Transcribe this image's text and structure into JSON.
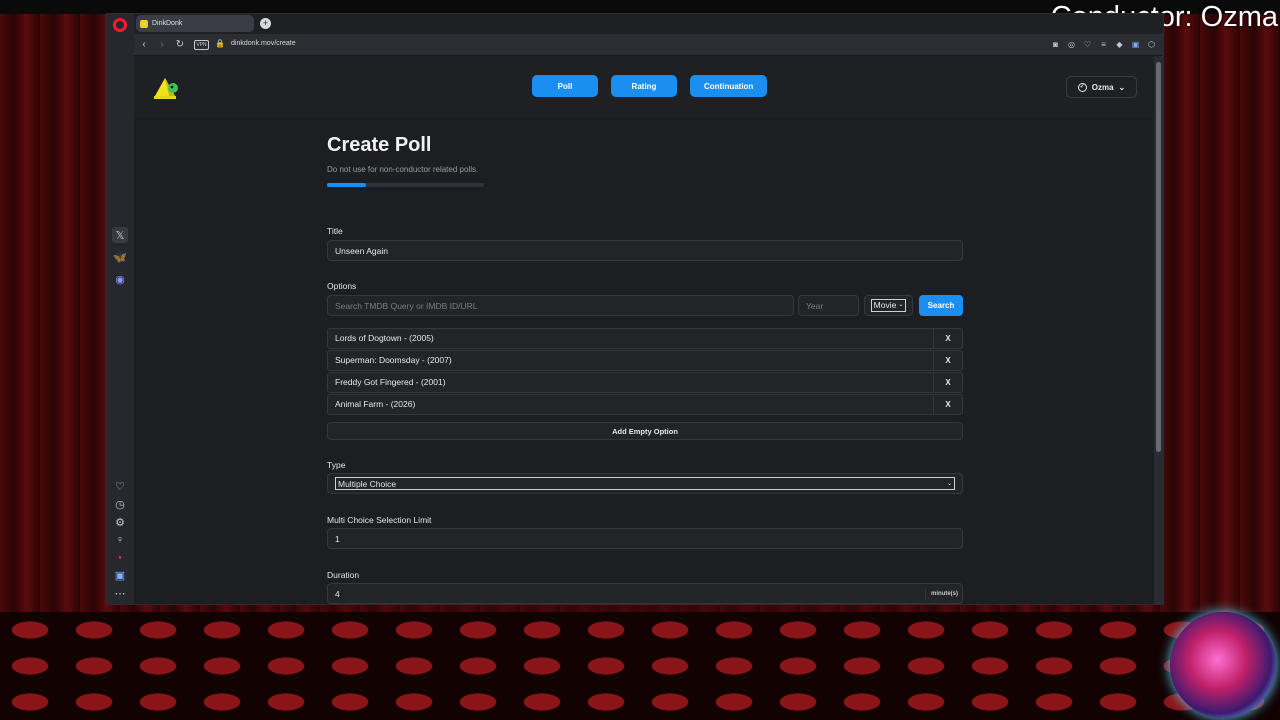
{
  "overlay": {
    "conductor_text": "Conductor: Ozma"
  },
  "browser": {
    "tab_title": "DinkDonk",
    "url": "dinkdonk.mov/create",
    "vpn_label": "VPN"
  },
  "header": {
    "nav": [
      "Poll",
      "Rating",
      "Continuation"
    ],
    "user_name": "Ozma"
  },
  "form": {
    "page_title": "Create Poll",
    "subtitle": "Do not use for non-conductor related polls.",
    "progress_fraction": 0.25,
    "title_label": "Title",
    "title_value": "Unseen Again",
    "options_label": "Options",
    "search_placeholder": "Search TMDB Query or IMDB ID/URL",
    "year_placeholder": "Year",
    "media_type": "Movie",
    "search_button": "Search",
    "options": [
      "Lords of Dogtown - (2005)",
      "Superman: Doomsday - (2007)",
      "Freddy Got Fingered - (2001)",
      "Animal Farm - (2026)"
    ],
    "remove_label": "X",
    "add_empty_option": "Add Empty Option",
    "type_label": "Type",
    "type_value": "Multiple Choice",
    "limit_label": "Multi Choice Selection Limit",
    "limit_value": "1",
    "duration_label": "Duration",
    "duration_value": "4",
    "duration_unit": "minute(s)"
  },
  "colors": {
    "accent": "#1b8ef2",
    "page_bg": "#1d1e22",
    "opera_red": "#ff1b2d"
  }
}
